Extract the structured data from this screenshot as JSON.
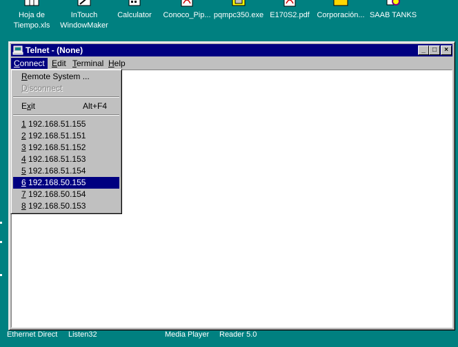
{
  "desktop": {
    "icons": [
      {
        "label_line1": "Hoja de",
        "label_line2": "Tiempo.xls"
      },
      {
        "label_line1": "InTouch",
        "label_line2": "WindowMaker"
      },
      {
        "label_line1": "Calculator",
        "label_line2": ""
      },
      {
        "label_line1": "Conoco_Pip...",
        "label_line2": ""
      },
      {
        "label_line1": "pqmpc350.exe",
        "label_line2": ""
      },
      {
        "label_line1": "E170S2.pdf",
        "label_line2": ""
      },
      {
        "label_line1": "Corporación...",
        "label_line2": ""
      },
      {
        "label_line1": "SAAB TANKS",
        "label_line2": ""
      }
    ],
    "bottom_labels": [
      "Ethernet Direct",
      "Listen32",
      "Media Player",
      "Reader 5.0"
    ]
  },
  "window": {
    "title": "Telnet - (None)",
    "controls": {
      "minimize": "_",
      "maximize": "□",
      "close": "×"
    }
  },
  "menubar": {
    "connect": {
      "u": "C",
      "rest": "onnect"
    },
    "edit": {
      "u": "E",
      "rest": "dit"
    },
    "terminal": {
      "u": "T",
      "rest": "erminal"
    },
    "help": {
      "u": "H",
      "rest": "elp"
    }
  },
  "connect_menu": {
    "remote_system": {
      "u": "R",
      "rest": "emote System ..."
    },
    "disconnect": {
      "u": "D",
      "rest": "isconnect"
    },
    "exit": {
      "pre": "E",
      "u": "x",
      "rest": "it",
      "accel": "Alt+F4"
    },
    "recent": [
      {
        "num": "1",
        "host": " 192.168.51.155"
      },
      {
        "num": "2",
        "host": " 192.168.51.151"
      },
      {
        "num": "3",
        "host": " 192.168.51.152"
      },
      {
        "num": "4",
        "host": " 192.168.51.153"
      },
      {
        "num": "5",
        "host": " 192.168.51.154"
      },
      {
        "num": "6",
        "host": " 192.168.50.155"
      },
      {
        "num": "7",
        "host": " 192.168.50.154"
      },
      {
        "num": "8",
        "host": " 192.168.50.153"
      }
    ],
    "selected_index": 5
  },
  "colors": {
    "desktop": "#008080",
    "title_bar": "#000080",
    "highlight": "#000080"
  },
  "icons": {
    "window_app": "computer-icon",
    "desktop": [
      "spreadsheet-icon",
      "intouch-icon",
      "calculator-icon",
      "pdf-icon",
      "exe-icon",
      "pdf-icon",
      "folder-icon",
      "saab-icon"
    ]
  }
}
